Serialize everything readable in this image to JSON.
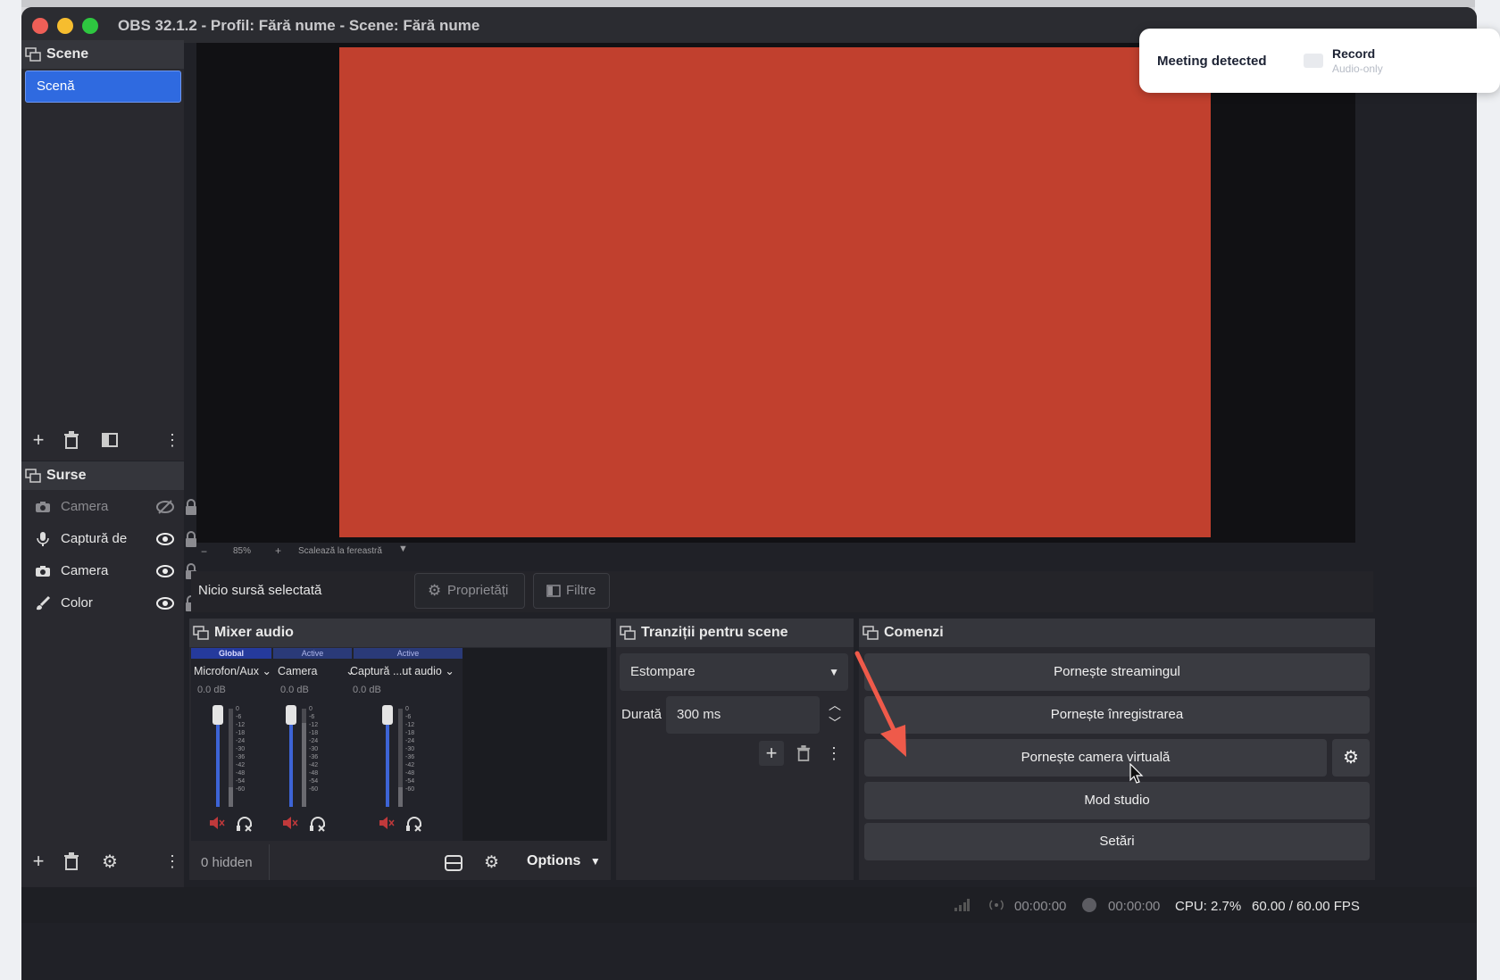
{
  "window": {
    "title": "OBS 32.1.2 - Profil: Fără nume - Scene: Fără nume"
  },
  "scenes": {
    "title": "Scene",
    "items": [
      "Scenă"
    ]
  },
  "sources": {
    "title": "Surse",
    "items": [
      {
        "label": "Camera",
        "icon": "camera-icon",
        "visible": false
      },
      {
        "label": "Captură de",
        "icon": "microphone-icon",
        "visible": true
      },
      {
        "label": "Camera",
        "icon": "camera-icon",
        "visible": true
      },
      {
        "label": "Color",
        "icon": "brush-icon",
        "visible": true
      }
    ]
  },
  "preview": {
    "canvas_color": "#c1402e",
    "zoom_out": "−",
    "zoom_level": "85%",
    "zoom_in": "+",
    "scale_label": "Scalează la fereastră"
  },
  "context": {
    "no_source": "Nicio sursă selectată",
    "properties": "Proprietăți",
    "filters": "Filtre"
  },
  "mixer": {
    "title": "Mixer audio",
    "strips": [
      {
        "tag": "Global",
        "name": "Microfon/Aux",
        "db": "0.0 dB",
        "level": 0.2
      },
      {
        "tag": "Active",
        "name": "Camera",
        "db": "0.0 dB",
        "level": 0.85
      },
      {
        "tag": "Active",
        "name": "Captură ...ut audio",
        "db": "0.0 dB",
        "level": 0.2
      }
    ],
    "meter_scale": [
      "0",
      "-6",
      "-12",
      "-18",
      "-24",
      "-30",
      "-36",
      "-42",
      "-48",
      "-54",
      "-60"
    ],
    "hidden_label": "0 hidden",
    "options_label": "Options"
  },
  "transitions": {
    "title": "Tranziții pentru scene",
    "selected": "Estompare",
    "duration_label": "Durată",
    "duration_value": "300 ms"
  },
  "commands": {
    "title": "Comenzi",
    "stream": "Pornește streamingul",
    "record": "Pornește înregistrarea",
    "virtual_cam": "Pornește camera virtuală",
    "studio": "Mod studio",
    "settings": "Setări"
  },
  "status": {
    "stream_time": "00:00:00",
    "record_time": "00:00:00",
    "cpu": "CPU: 2.7%",
    "fps": "60.00 / 60.00 FPS"
  },
  "notification": {
    "title": "Meeting detected",
    "action": "Record",
    "subtitle": "Audio-only"
  },
  "colors": {
    "accent": "#2f6ae0",
    "arrow": "#ef5a4a",
    "mute": "#c0393b"
  }
}
